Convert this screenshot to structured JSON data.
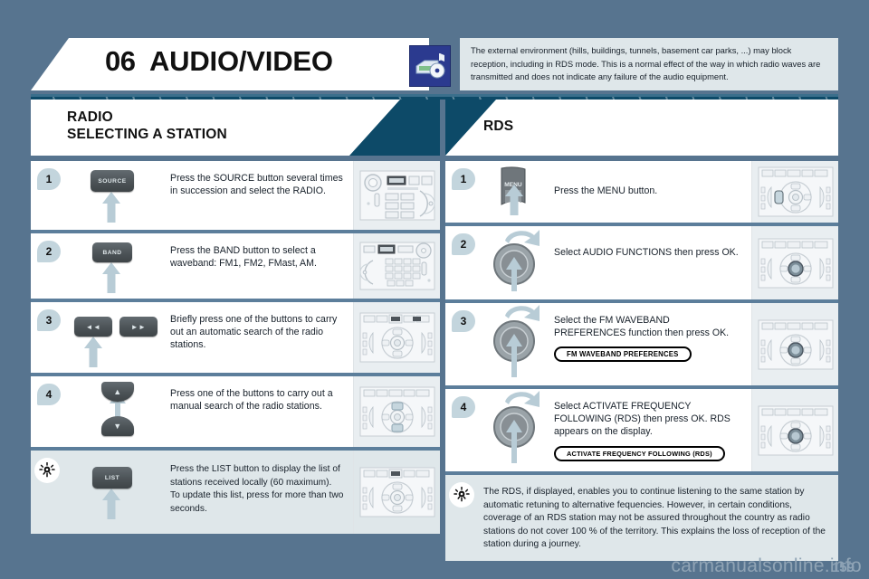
{
  "header": {
    "chapter_number": "06",
    "chapter_title": "AUDIO/VIDEO",
    "icon": "audio-video-icon",
    "note": "The external environment (hills, buildings, tunnels, basement car parks, ...) may block reception, including in RDS mode. This is a normal effect of the way in which radio waves are transmitted and does not indicate any failure of the audio equipment."
  },
  "left_section": {
    "title_line1": "RADIO",
    "title_line2": "SELECTING A STATION",
    "steps": [
      {
        "marker": "1",
        "control": "SOURCE",
        "text": "Press the SOURCE button several times in succession and select the RADIO.",
        "illustration": "car-radio-faceplate"
      },
      {
        "marker": "2",
        "control": "BAND",
        "text": "Press the BAND button to select a waveband: FM1, FM2, FMast, AM.",
        "illustration": "car-radio-keypad"
      },
      {
        "marker": "3",
        "control_left": "◄◄",
        "control_right": "►►",
        "text": "Briefly press one of the buttons to carry out an automatic search of the radio stations.",
        "illustration": "steering-wheel-controls"
      },
      {
        "marker": "4",
        "control_up": "▲",
        "control_down": "▼",
        "text": "Press one of the buttons to carry out a manual search of the radio stations.",
        "illustration": "steering-wheel-controls"
      },
      {
        "marker": "bulb-icon",
        "control": "LIST",
        "text": "Press the LIST button to display the list of stations received locally (60 maximum).\nTo update this list, press for more than two seconds.",
        "illustration": "steering-wheel-controls"
      }
    ]
  },
  "right_section": {
    "title_line1": "RDS",
    "steps": [
      {
        "marker": "1",
        "control": "MENU",
        "text": "Press the MENU button.",
        "illustration": "steering-wheel-controls"
      },
      {
        "marker": "2",
        "control": "rotary-knob",
        "text": "Select AUDIO FUNCTIONS then press OK.",
        "illustration": "steering-wheel-controls"
      },
      {
        "marker": "3",
        "control": "rotary-knob",
        "text": "Select the FM WAVEBAND PREFERENCES function then press OK.",
        "pill": "FM WAVEBAND PREFERENCES",
        "illustration": "steering-wheel-controls"
      },
      {
        "marker": "4",
        "control": "rotary-knob",
        "text": "Select ACTIVATE FREQUENCY FOLLOWING (RDS) then press OK. RDS appears on the display.",
        "pill": "ACTIVATE FREQUENCY FOLLOWING (RDS)",
        "illustration": "steering-wheel-controls"
      },
      {
        "marker": "bulb-icon",
        "text": "The RDS, if displayed, enables you to continue listening to the same station by automatic retuning to alternative fequencies. However, in certain conditions, coverage of an RDS station may not be assured throughout the country as radio stations do not cover 100 % of the territory. This explains the loss of reception of the station during a journey."
      }
    ]
  },
  "footer": {
    "page_number": "159",
    "watermark": "carmanualsonline.info"
  },
  "colors": {
    "page_background": "#57748f",
    "navy": "#0d4a68",
    "note_background": "#dfe7ea",
    "marker_bubble": "#c3d5dd",
    "arrow": "#b8ccd6",
    "illustration_background": "#e9eef1"
  }
}
